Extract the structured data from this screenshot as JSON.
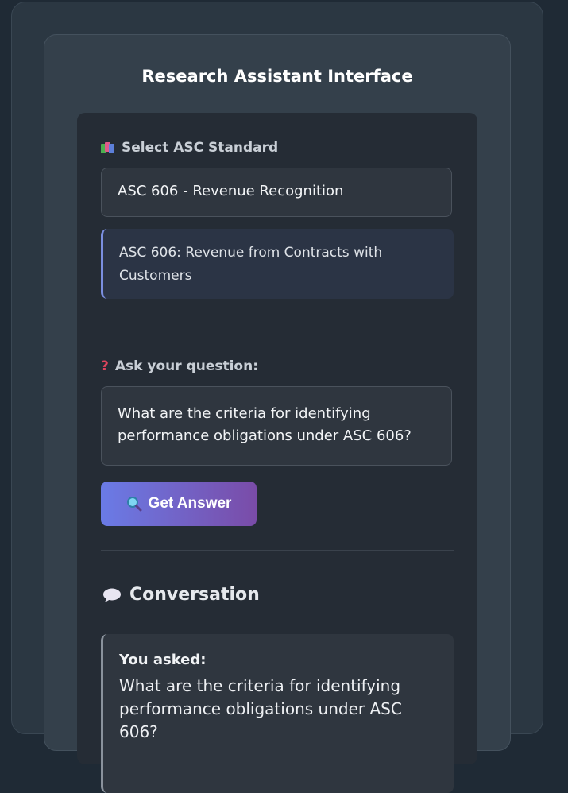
{
  "page": {
    "title": "Research Assistant Interface"
  },
  "standard_select": {
    "label": "Select ASC Standard",
    "icon": "books-icon",
    "selected_value": "ASC 606 - Revenue Recognition"
  },
  "standard_info": {
    "text": "ASC 606: Revenue from Contracts with Customers"
  },
  "question": {
    "label": "Ask your question:",
    "icon": "question-mark-icon",
    "value": "What are the criteria for identifying performance obligations under ASC 606?"
  },
  "get_answer_button": {
    "label": "Get Answer",
    "icon": "magnifier-icon"
  },
  "conversation": {
    "title": "Conversation",
    "icon": "speech-bubble-icon",
    "messages": [
      {
        "heading": "You asked:",
        "text": "What are the criteria for identifying performance obligations under ASC 606?"
      }
    ]
  },
  "colors": {
    "background": "#1f2a35",
    "card": "#34404b",
    "panel": "#252c35",
    "accent_start": "#6a7be6",
    "accent_end": "#7a4ca8",
    "info_border": "#7b8fe0"
  }
}
